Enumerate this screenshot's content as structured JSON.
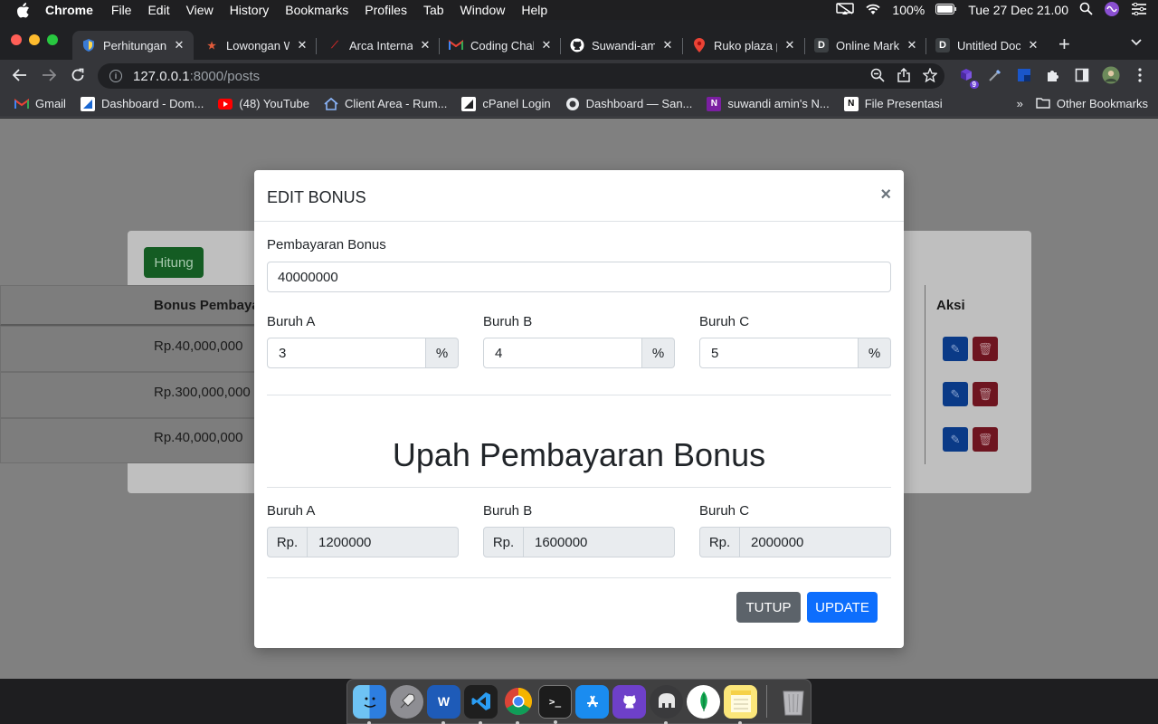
{
  "menubar": {
    "app": "Chrome",
    "items": [
      "File",
      "Edit",
      "View",
      "History",
      "Bookmarks",
      "Profiles",
      "Tab",
      "Window",
      "Help"
    ],
    "battery": "100%",
    "clock": "Tue 27 Dec  21.00"
  },
  "tabs": [
    {
      "title": "Perhitungan",
      "active": true
    },
    {
      "title": "Lowongan W"
    },
    {
      "title": "Arca Internat"
    },
    {
      "title": "Coding Chal"
    },
    {
      "title": "Suwandi-am"
    },
    {
      "title": "Ruko plaza p"
    },
    {
      "title": "Online Mark"
    },
    {
      "title": "Untitled Doc"
    }
  ],
  "address": {
    "host": "127.0.0.1",
    "path": ":8000/posts"
  },
  "extension_badge": "9",
  "bookmarks": [
    {
      "label": "Gmail"
    },
    {
      "label": "Dashboard - Dom..."
    },
    {
      "label": "(48) YouTube"
    },
    {
      "label": "Client Area - Rum..."
    },
    {
      "label": "cPanel Login"
    },
    {
      "label": "Dashboard — San..."
    },
    {
      "label": "suwandi amin's N..."
    },
    {
      "label": "File Presentasi"
    }
  ],
  "bookmarks_more": "»",
  "other_bookmarks": "Other Bookmarks",
  "page": {
    "hitung_button": "Hitung",
    "table": {
      "header_bonus": "Bonus Pembaya",
      "header_aksi": "Aksi",
      "rows": [
        "Rp.40,000,000",
        "Rp.300,000,000",
        "Rp.40,000,000"
      ]
    }
  },
  "modal": {
    "title": "EDIT BONUS",
    "close": "×",
    "pembayaran_label": "Pembayaran Bonus",
    "pembayaran_value": "40000000",
    "percent_inputs": [
      {
        "label": "Buruh A",
        "value": "3",
        "unit": "%"
      },
      {
        "label": "Buruh B",
        "value": "4",
        "unit": "%"
      },
      {
        "label": "Buruh C",
        "value": "5",
        "unit": "%"
      }
    ],
    "section_title": "Upah Pembayaran Bonus",
    "results": [
      {
        "label": "Buruh A",
        "prefix": "Rp.",
        "value": "1200000"
      },
      {
        "label": "Buruh B",
        "prefix": "Rp.",
        "value": "1600000"
      },
      {
        "label": "Buruh C",
        "prefix": "Rp.",
        "value": "2000000"
      }
    ],
    "close_button": "TUTUP",
    "update_button": "UPDATE"
  },
  "colors": {
    "primary": "#0d6efd",
    "secondary": "#5c636a",
    "success": "#198754",
    "danger": "#dc3545"
  }
}
